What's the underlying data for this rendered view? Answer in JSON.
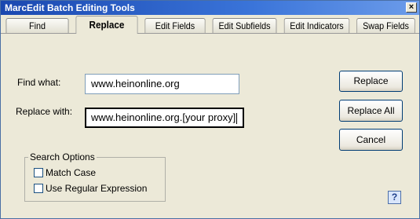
{
  "window": {
    "title": "MarcEdit Batch Editing Tools",
    "close_glyph": "×"
  },
  "tabs": [
    {
      "label": "Find"
    },
    {
      "label": "Replace"
    },
    {
      "label": "Edit Fields"
    },
    {
      "label": "Edit Subfields"
    },
    {
      "label": "Edit Indicators"
    },
    {
      "label": "Swap Fields"
    }
  ],
  "form": {
    "find_label": "Find what:",
    "find_value": "www.heinonline.org",
    "replace_label": "Replace with:",
    "replace_value": "www.heinonline.org.[your proxy]"
  },
  "buttons": {
    "replace": "Replace",
    "replace_all": "Replace All",
    "cancel": "Cancel"
  },
  "search_options": {
    "title": "Search Options",
    "match_case": {
      "label": "Match Case",
      "checked": false
    },
    "use_regex": {
      "label": "Use Regular Expression",
      "checked": false
    }
  },
  "help": {
    "glyph": "?"
  }
}
